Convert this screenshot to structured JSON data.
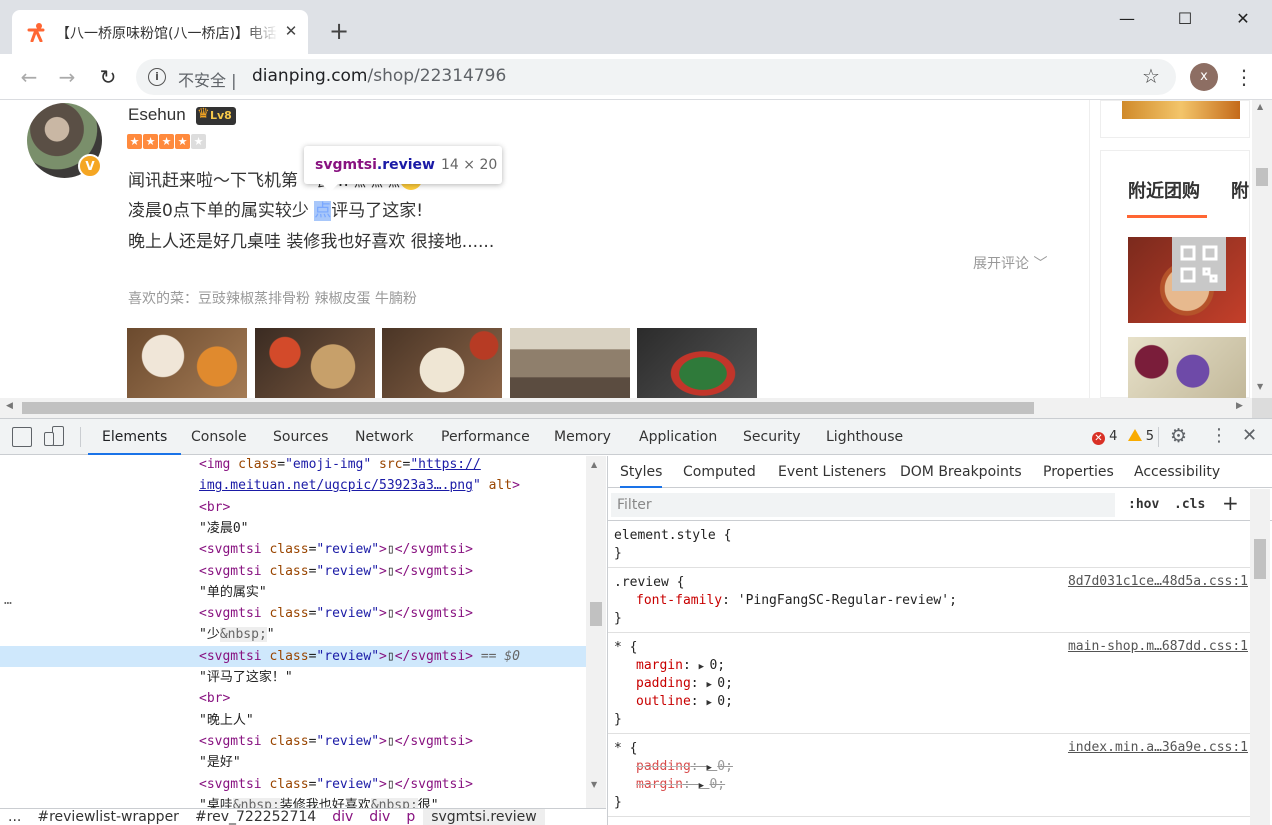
{
  "browser": {
    "tab_title": "【八一桥原味粉馆(八一桥店)】电话,地址,价格,营业时间",
    "tab_close": "✕",
    "new_tab": "+",
    "window": {
      "minimize": "—",
      "maximize": "☐",
      "close": "✕"
    },
    "nav": {
      "back": "←",
      "forward": "→",
      "reload": "↻"
    },
    "security_label": "不安全",
    "url_host": "dianping.com",
    "url_path": "/shop/22314796",
    "profile_initial": "x"
  },
  "review": {
    "username": "Esehun",
    "level": "Lv8",
    "vip": "V",
    "stars": 4,
    "line1_a": "闻讯赶来啦～下飞机第",
    "line1_b": "餐…嘿嘿嘿",
    "line2_a": "凌晨0点下单的属实较少 ",
    "line2_hl": "点",
    "line2_b": "评马了这家!",
    "line3": "晚上人还是好几桌哇 装修我也好喜欢 很接地......",
    "expand": "展开评论 ﹀",
    "favorite_dishes": "喜欢的菜：豆豉辣椒蒸排骨粉 辣椒皮蛋 牛腩粉"
  },
  "tooltip": {
    "tag": "svgmtsi",
    "cls": ".review",
    "size": "14 × 20"
  },
  "sidebar": {
    "tab1": "附近团购",
    "tab2": "附"
  },
  "devtools": {
    "tabs": [
      "Elements",
      "Console",
      "Sources",
      "Network",
      "Performance",
      "Memory",
      "Application",
      "Security",
      "Lighthouse"
    ],
    "errors": "4",
    "warnings": "5",
    "dom_lines": [
      {
        "html": "<span class='tag'>&lt;img</span> <span class='attr'>class</span>=<span class='val'>\"emoji-img\"</span> <span class='attr'>src</span>=<span class='val link'>\"https://</span>"
      },
      {
        "html": "<span class='link'>img.meituan.net/ugcpic/53923a3….png</span><span class='val'>\"</span> <span class='attr'>alt</span><span class='tag'>&gt;</span>"
      },
      {
        "html": "<span class='tag'>&lt;br&gt;</span>"
      },
      {
        "html": "\"凌晨0\""
      },
      {
        "html": "<span class='tag'>&lt;svgmtsi</span> <span class='attr'>class</span>=<span class='val'>\"review\"</span><span class='tag'>&gt;</span>▯<span class='tag'>&lt;/svgmtsi&gt;</span>"
      },
      {
        "html": "<span class='tag'>&lt;svgmtsi</span> <span class='attr'>class</span>=<span class='val'>\"review\"</span><span class='tag'>&gt;</span>▯<span class='tag'>&lt;/svgmtsi&gt;</span>"
      },
      {
        "html": "\"单的属实\""
      },
      {
        "html": "<span class='tag'>&lt;svgmtsi</span> <span class='attr'>class</span>=<span class='val'>\"review\"</span><span class='tag'>&gt;</span>▯<span class='tag'>&lt;/svgmtsi&gt;</span>"
      },
      {
        "html": "\"少<span class='ent'>&amp;nbsp;</span>\""
      },
      {
        "html": "<span class='tag'>&lt;svgmtsi</span> <span class='attr'>class</span>=<span class='val'>\"review\"</span><span class='tag'>&gt;</span>▯<span class='tag'>&lt;/svgmtsi&gt;</span> <span style='color:#666;font-style:italic'>== $0</span>",
        "selected": true
      },
      {
        "html": "\"评马了这家！\""
      },
      {
        "html": "<span class='tag'>&lt;br&gt;</span>"
      },
      {
        "html": "\"晚上人\""
      },
      {
        "html": "<span class='tag'>&lt;svgmtsi</span> <span class='attr'>class</span>=<span class='val'>\"review\"</span><span class='tag'>&gt;</span>▯<span class='tag'>&lt;/svgmtsi&gt;</span>"
      },
      {
        "html": "\"是好\""
      },
      {
        "html": "<span class='tag'>&lt;svgmtsi</span> <span class='attr'>class</span>=<span class='val'>\"review\"</span><span class='tag'>&gt;</span>▯<span class='tag'>&lt;/svgmtsi&gt;</span>"
      },
      {
        "html": "\"桌哇<span class='ent'>&amp;nbsp;</span>装修我也好喜欢<span class='ent'>&amp;nbsp;</span>很\""
      }
    ],
    "breadcrumbs": [
      "...",
      "#reviewlist-wrapper",
      "#rev_722252714",
      "div",
      "div",
      "p",
      "svgmtsi.review"
    ],
    "styles_tabs": [
      "Styles",
      "Computed",
      "Event Listeners",
      "DOM Breakpoints",
      "Properties",
      "Accessibility"
    ],
    "filter_placeholder": "Filter",
    "hov": ":hov",
    "cls": ".cls",
    "rules": [
      {
        "selector": "element.style {",
        "source": "",
        "props": [],
        "close": "}"
      },
      {
        "selector": ".review {",
        "source": "8d7d031c1ce…48d5a.css:1",
        "props": [
          {
            "name": "font-family",
            "value": "'PingFangSC-Regular-review';",
            "strike": false,
            "tri": false
          }
        ],
        "close": "}"
      },
      {
        "selector": "* {",
        "source": "main-shop.m…687dd.css:1",
        "props": [
          {
            "name": "margin",
            "value": "0;",
            "strike": false,
            "tri": true
          },
          {
            "name": "padding",
            "value": "0;",
            "strike": false,
            "tri": true
          },
          {
            "name": "outline",
            "value": "0;",
            "strike": false,
            "tri": true
          }
        ],
        "close": "}"
      },
      {
        "selector": "* {",
        "source": "index.min.a…36a9e.css:1",
        "props": [
          {
            "name": "padding",
            "value": "0;",
            "strike": true,
            "tri": true
          },
          {
            "name": "margin",
            "value": "0;",
            "strike": true,
            "tri": true
          }
        ],
        "close": "}"
      }
    ]
  }
}
